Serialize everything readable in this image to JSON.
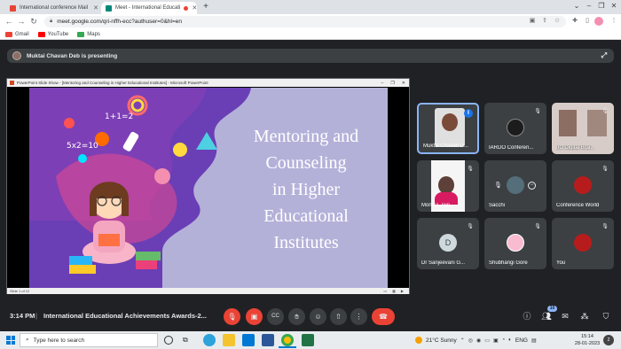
{
  "browser": {
    "tabs": [
      {
        "title": "International conference Mail",
        "favicon_color": "#ea4335",
        "active": false
      },
      {
        "title": "Meet - International Educati",
        "favicon_color": "#00897b",
        "active": true
      }
    ],
    "new_tab_label": "+",
    "url": "meet.google.com/qri-nffh-ecc?authuser=0&hl=en",
    "bookmarks": [
      {
        "label": "Gmail",
        "color": "#ea4335"
      },
      {
        "label": "YouTube",
        "color": "#ff0000"
      },
      {
        "label": "Maps",
        "color": "#34a853"
      }
    ]
  },
  "meet": {
    "presenting_text": "Muktai Chavan Deb is presenting",
    "ppt_window_title": "PowerPoint Slide Show - [Mentoring and Counseling in Higher Educational Institutes] - Microsoft PowerPoint",
    "slide_title_lines": [
      "Mentoring and",
      "Counseling",
      "in Higher",
      "Educational",
      "Institutes"
    ],
    "slide_decor_text": [
      "1+1=2",
      "5x2=10"
    ],
    "ppt_status_left": "Slide 1 of 12",
    "participants": [
      {
        "name": "Muktai Chavan D...",
        "type": "video-speaking"
      },
      {
        "name": "IARDO Conferen...",
        "type": "image"
      },
      {
        "name": "IIC Digital Brai...",
        "type": "image"
      },
      {
        "name": "Monika Jain",
        "type": "video"
      },
      {
        "name": "Sacchi",
        "type": "avatar"
      },
      {
        "name": "Conference World",
        "type": "avatar"
      },
      {
        "name": "Dr Sanjeevani G...",
        "type": "initial",
        "initial": "D"
      },
      {
        "name": "Shubhangi Gore",
        "type": "avatar"
      },
      {
        "name": "You",
        "type": "avatar"
      }
    ],
    "time": "3:14 PM",
    "separator": "|",
    "meeting_name": "International Educational Achievements Awards-2...",
    "participant_count": "10",
    "accent_red": "#ea4335"
  },
  "taskbar": {
    "search_placeholder": "Type here to search",
    "weather": "21°C  Sunny",
    "language": "ENG",
    "time": "15:14",
    "date": "28-01-2023",
    "notifications": "2"
  }
}
